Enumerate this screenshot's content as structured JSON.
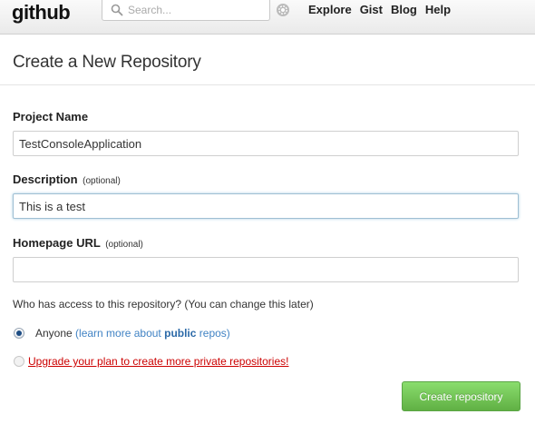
{
  "header": {
    "logo_text": "github",
    "search": {
      "placeholder": "Search..."
    },
    "nav": [
      "Explore",
      "Gist",
      "Blog",
      "Help"
    ]
  },
  "page": {
    "title": "Create a New Repository"
  },
  "form": {
    "project_name": {
      "label": "Project Name",
      "value": "TestConsoleApplication"
    },
    "description": {
      "label": "Description",
      "optional": "(optional)",
      "value": "This is a test"
    },
    "homepage": {
      "label": "Homepage URL",
      "optional": "(optional)",
      "value": ""
    },
    "access_question": "Who has access to this repository? (You can change this later)",
    "access_options": {
      "anyone": {
        "label": "Anyone",
        "link_pre": "(learn more about ",
        "link_bold": "public",
        "link_post": " repos)",
        "selected": true
      },
      "private": {
        "label": "Upgrade your plan to create more private repositories!",
        "selected": false,
        "disabled": true
      }
    },
    "submit_label": "Create repository"
  },
  "colors": {
    "accent_link": "#4183c4",
    "upgrade_red": "#cc0000",
    "button_green": "#60b044"
  }
}
